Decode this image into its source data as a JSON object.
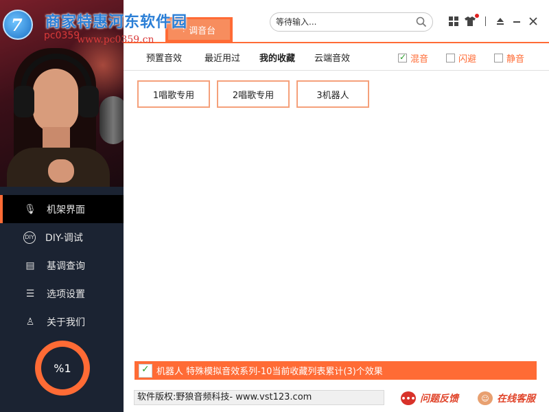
{
  "logo": {
    "title": "商家特惠",
    "watermark_site": "河东软件园",
    "watermark_code": "pc0359",
    "watermark_url": "www.pc0359.cn"
  },
  "top": {
    "mixer_tab": "调音台",
    "search_placeholder": "等待输入..."
  },
  "subtabs": [
    "预置音效",
    "最近用过",
    "我的收藏",
    "云端音效"
  ],
  "active_subtab": "我的收藏",
  "options": [
    {
      "label": "混音",
      "checked": true
    },
    {
      "label": "闪避",
      "checked": false
    },
    {
      "label": "静音",
      "checked": false
    }
  ],
  "favorites": [
    "1唱歌专用",
    "2唱歌专用",
    "3机器人"
  ],
  "sidebar": {
    "items": [
      {
        "label": "机架界面",
        "icon": "microphone-icon",
        "glyph": "🎙"
      },
      {
        "label": "DIY-调试",
        "icon": "diy-icon",
        "glyph": "DIY"
      },
      {
        "label": "基调查询",
        "icon": "document-icon",
        "glyph": "▤"
      },
      {
        "label": "选项设置",
        "icon": "sliders-icon",
        "glyph": "☰"
      },
      {
        "label": "关于我们",
        "icon": "user-icon",
        "glyph": "♙"
      }
    ],
    "gauge_label": "%1"
  },
  "status_text": "机器人 特殊模拟音效系列-10当前收藏列表累计(3)个效果",
  "footer": {
    "copyright": "软件版权:野狼音频科技- www.vst123.com",
    "feedback": "问题反馈",
    "support": "在线客服"
  },
  "colors": {
    "accent": "#ff6b35",
    "sidebar": "#1b2332"
  }
}
